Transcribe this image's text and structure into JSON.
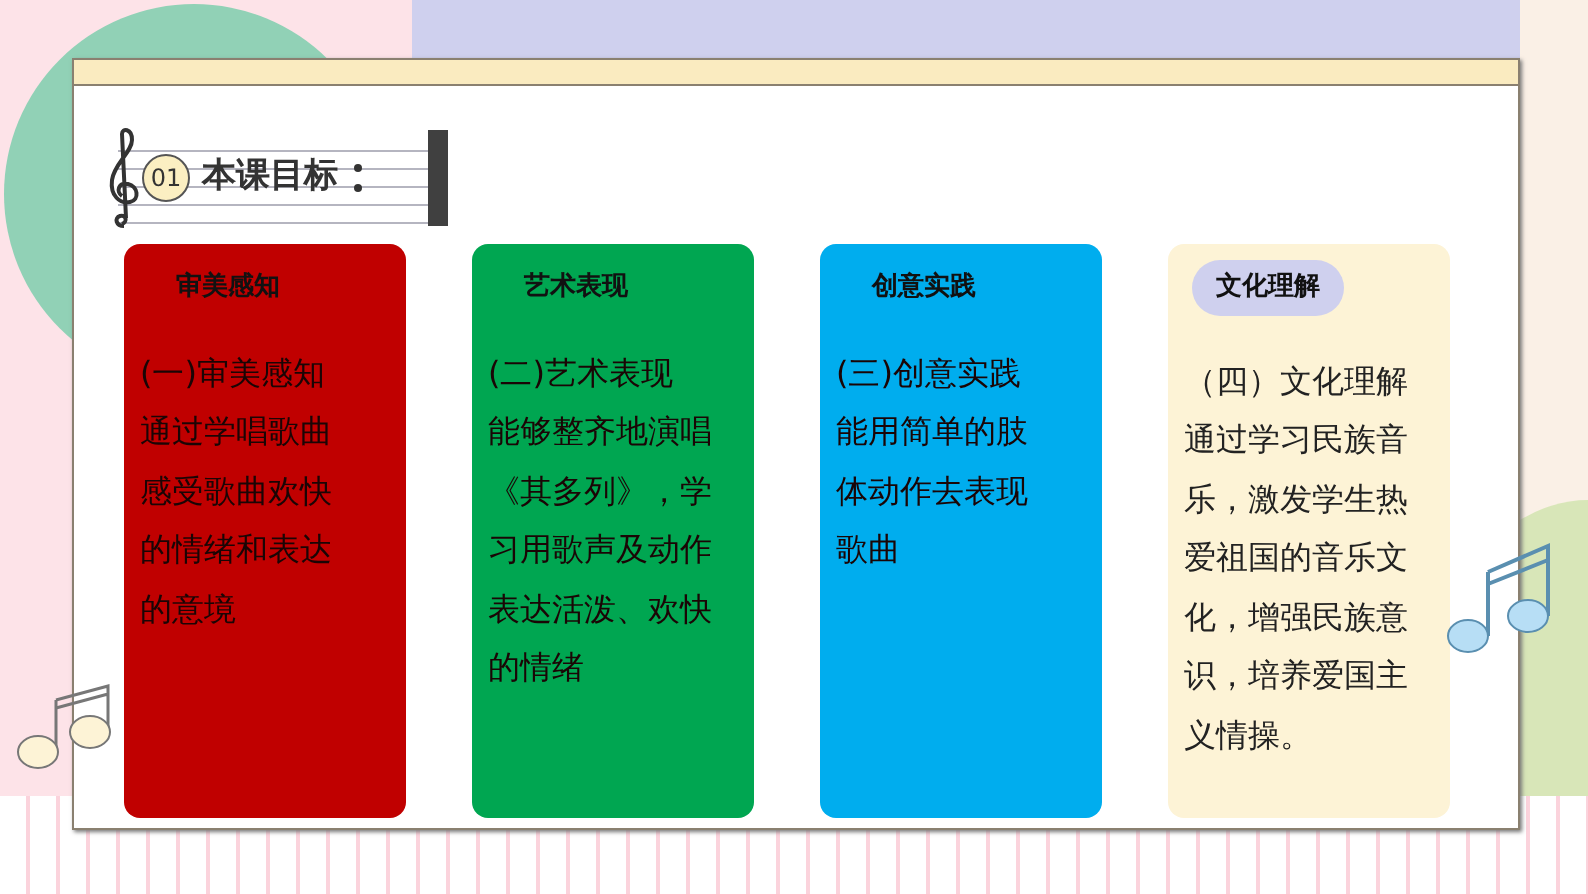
{
  "heading": {
    "number": "01",
    "title": "本课目标"
  },
  "cards": [
    {
      "kind": "plain",
      "color": "#c00000",
      "title": "审美感知",
      "lines": [
        "(一)审美感知",
        "通过学唱歌曲",
        "感受歌曲欢快",
        "的情绪和表达",
        "的意境"
      ]
    },
    {
      "kind": "plain",
      "color": "#00a651",
      "title": "艺术表现",
      "lines": [
        "(二)艺术表现",
        "能够整齐地演唱",
        "《其多列》，学",
        "习用歌声及动作",
        "表达活泼、欢快",
        "的情绪"
      ]
    },
    {
      "kind": "plain",
      "color": "#00adee",
      "title": "创意实践",
      "lines": [
        "(三)创意实践",
        "能用简单的肢",
        "体动作去表现",
        "歌曲"
      ]
    },
    {
      "kind": "pill",
      "color": "#fdf3d6",
      "title": "文化理解",
      "lines": [
        "（四）文化理解",
        "通过学习民族音",
        "乐，激发学生热",
        "爱祖国的音乐文",
        "化，增强民族意",
        "识，培养爱国主",
        "义情操。"
      ]
    }
  ]
}
